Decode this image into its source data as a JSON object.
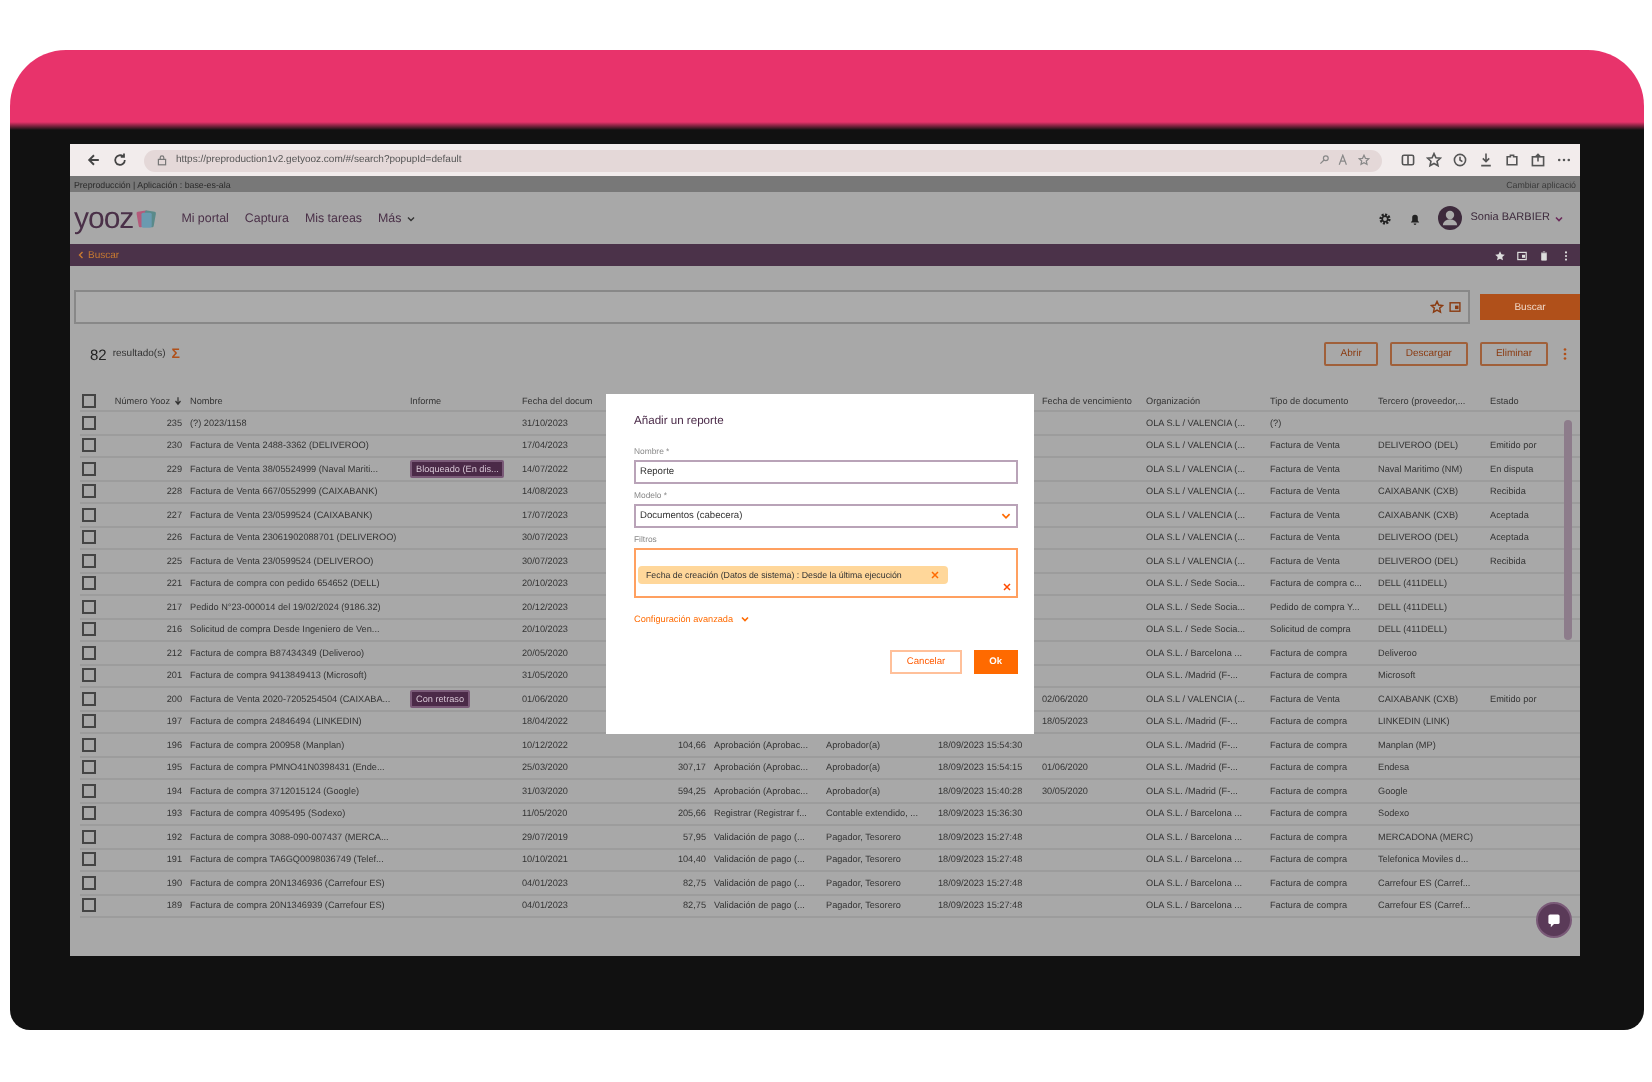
{
  "browser": {
    "url": "https://preproduction1v2.getyooz.com/#/search?popupId=default"
  },
  "environment_bar": {
    "label": "Preproducción | Aplicación : base-es-ala",
    "switch_link": "Cambiar aplicació"
  },
  "app_header": {
    "logo": "yooz",
    "nav": [
      {
        "label": "Mi portal",
        "dropdown": false
      },
      {
        "label": "Captura",
        "dropdown": false
      },
      {
        "label": "Mis tareas",
        "dropdown": false
      },
      {
        "label": "Más",
        "dropdown": true
      }
    ],
    "user": "Sonia BARBIER"
  },
  "breadcrumb": {
    "back": "Buscar"
  },
  "search": {
    "button": "Buscar"
  },
  "results": {
    "count": "82",
    "label": "resultado(s)",
    "sum_symbol": "Σ",
    "actions": [
      "Abrir",
      "Descargar",
      "Eliminar"
    ]
  },
  "table": {
    "all_checked": false,
    "columns": [
      {
        "label": "Número Yooz",
        "sorted": true
      },
      {
        "label": "Nombre",
        "sorted": false
      },
      {
        "label": "Informe",
        "sorted": false
      },
      {
        "label": "Fecha del docum",
        "sorted": false
      },
      {
        "label": "Fecha de vencimiento",
        "sorted": false
      },
      {
        "label": "Organización",
        "sorted": false
      },
      {
        "label": "Tipo de documento",
        "sorted": false
      },
      {
        "label": "Tercero (proveedor,...",
        "sorted": false
      },
      {
        "label": "Estado",
        "sorted": false
      }
    ],
    "rows": [
      {
        "checked": false,
        "number": "235",
        "name": "(?) 2023/1158",
        "document_date": "31/10/2023",
        "organization": "OLA S.L / VALENCIA (...",
        "document_type": "(?)"
      },
      {
        "checked": false,
        "number": "230",
        "name": "Factura de Venta 2488-3362 (DELIVEROO)",
        "document_date": "17/04/2023",
        "organization": "OLA S.L / VALENCIA (...",
        "document_type": "Factura de Venta",
        "third_party": "DELIVEROO (DEL)",
        "status": "Emitido por"
      },
      {
        "checked": false,
        "number": "229",
        "name": "Factura de Venta 38/05524999 (Naval Mariti...",
        "report": "Bloqueado (En dis...",
        "document_date": "14/07/2022",
        "organization": "OLA S.L / VALENCIA (...",
        "document_type": "Factura de Venta",
        "third_party": "Naval Maritimo (NM)",
        "status": "En disputa"
      },
      {
        "checked": false,
        "number": "228",
        "name": "Factura de Venta 667/0552999 (CAIXABANK)",
        "document_date": "14/08/2023",
        "organization": "OLA S.L / VALENCIA (...",
        "document_type": "Factura de Venta",
        "third_party": "CAIXABANK (CXB)",
        "status": "Recibida"
      },
      {
        "checked": false,
        "number": "227",
        "name": "Factura de Venta 23/0599524 (CAIXABANK)",
        "document_date": "17/07/2023",
        "organization": "OLA S.L / VALENCIA (...",
        "document_type": "Factura de Venta",
        "third_party": "CAIXABANK (CXB)",
        "status": "Aceptada"
      },
      {
        "checked": false,
        "number": "226",
        "name": "Factura de Venta 23061902088701 (DELIVEROO)",
        "document_date": "30/07/2023",
        "organization": "OLA S.L / VALENCIA (...",
        "document_type": "Factura de Venta",
        "third_party": "DELIVEROO (DEL)",
        "status": "Aceptada"
      },
      {
        "checked": false,
        "number": "225",
        "name": "Factura de Venta 23/0599524 (DELIVEROO)",
        "document_date": "30/07/2023",
        "organization": "OLA S.L / VALENCIA (...",
        "document_type": "Factura de Venta",
        "third_party": "DELIVEROO (DEL)",
        "status": "Recibida"
      },
      {
        "checked": false,
        "number": "221",
        "name": "Factura de compra con pedido 654652 (DELL)",
        "document_date": "20/10/2023",
        "organization": "OLA S.L. / Sede Socia...",
        "document_type": "Factura de compra c...",
        "third_party": "DELL (411DELL)"
      },
      {
        "checked": false,
        "number": "217",
        "name": "Pedido N°23-000014 del 19/02/2024 (9186.32)",
        "document_date": "20/12/2023",
        "organization": "OLA S.L. / Sede Socia...",
        "document_type": "Pedido de compra Y...",
        "third_party": "DELL (411DELL)"
      },
      {
        "checked": false,
        "number": "216",
        "name": "Solicitud de compra Desde Ingeniero de Ven...",
        "document_date": "20/10/2023",
        "organization": "OLA S.L. / Sede Socia...",
        "document_type": "Solicitud de compra",
        "third_party": "DELL (411DELL)"
      },
      {
        "checked": false,
        "number": "212",
        "name": "Factura de compra B87434349 (Deliveroo)",
        "document_date": "20/05/2020",
        "organization": "OLA S.L. / Barcelona ...",
        "document_type": "Factura de compra",
        "third_party": "Deliveroo"
      },
      {
        "checked": false,
        "number": "201",
        "name": "Factura de compra 9413849413 (Microsoft)",
        "document_date": "31/05/2020",
        "organization": "OLA S.L. /Madrid (F-...",
        "document_type": "Factura de compra",
        "third_party": "Microsoft"
      },
      {
        "checked": false,
        "number": "200",
        "name": "Factura de Venta 2020-7205254504 (CAIXABA...",
        "report": "Con retraso",
        "document_date": "01/06/2020",
        "due_date": "02/06/2020",
        "organization": "OLA S.L / VALENCIA (...",
        "document_type": "Factura de Venta",
        "third_party": "CAIXABANK (CXB)",
        "status": "Emitido por"
      },
      {
        "checked": false,
        "number": "197",
        "name": "Factura de compra 24846494 (LINKEDIN)",
        "document_date": "18/04/2022",
        "due_date": "18/05/2023",
        "organization": "OLA S.L. /Madrid (F-...",
        "document_type": "Factura de compra",
        "third_party": "LINKEDIN (LINK)"
      },
      {
        "checked": false,
        "number": "196",
        "name": "Factura de compra 200958 (Manplan)",
        "document_date": "10/12/2022",
        "amount": "104,66",
        "stage": "Aprobación (Aprobac...",
        "role": "Aprobador(a)",
        "stage_date": "18/09/2023 15:54:30",
        "organization": "OLA S.L. /Madrid (F-...",
        "document_type": "Factura de compra",
        "third_party": "Manplan (MP)"
      },
      {
        "checked": false,
        "number": "195",
        "name": "Factura de compra PMNO41N0398431 (Ende...",
        "document_date": "25/03/2020",
        "amount": "307,17",
        "stage": "Aprobación (Aprobac...",
        "role": "Aprobador(a)",
        "stage_date": "18/09/2023 15:54:15",
        "due_date": "01/06/2020",
        "organization": "OLA S.L. /Madrid (F-...",
        "document_type": "Factura de compra",
        "third_party": "Endesa"
      },
      {
        "checked": false,
        "number": "194",
        "name": "Factura de compra 3712015124 (Google)",
        "document_date": "31/03/2020",
        "amount": "594,25",
        "stage": "Aprobación (Aprobac...",
        "role": "Aprobador(a)",
        "stage_date": "18/09/2023 15:40:28",
        "due_date": "30/05/2020",
        "organization": "OLA S.L. /Madrid (F-...",
        "document_type": "Factura de compra",
        "third_party": "Google"
      },
      {
        "checked": false,
        "number": "193",
        "name": "Factura de compra 4095495 (Sodexo)",
        "document_date": "11/05/2020",
        "amount": "205,66",
        "stage": "Registrar (Registrar f...",
        "role": "Contable extendido, ...",
        "stage_date": "18/09/2023 15:36:30",
        "organization": "OLA S.L. / Barcelona ...",
        "document_type": "Factura de compra",
        "third_party": "Sodexo"
      },
      {
        "checked": false,
        "number": "192",
        "name": "Factura de compra 3088-090-007437 (MERCA...",
        "document_date": "29/07/2019",
        "amount": "57,95",
        "stage": "Validación de pago (...",
        "role": "Pagador, Tesorero",
        "stage_date": "18/09/2023 15:27:48",
        "organization": "OLA S.L. / Barcelona ...",
        "document_type": "Factura de compra",
        "third_party": "MERCADONA (MERC)"
      },
      {
        "checked": false,
        "number": "191",
        "name": "Factura de compra TA6GQ0098036749 (Telef...",
        "document_date": "10/10/2021",
        "amount": "104,40",
        "stage": "Validación de pago (...",
        "role": "Pagador, Tesorero",
        "stage_date": "18/09/2023 15:27:48",
        "organization": "OLA S.L. / Barcelona ...",
        "document_type": "Factura de compra",
        "third_party": "Telefonica Moviles d..."
      },
      {
        "checked": false,
        "number": "190",
        "name": "Factura de compra 20N1346936 (Carrefour ES)",
        "document_date": "04/01/2023",
        "amount": "82,75",
        "stage": "Validación de pago (...",
        "role": "Pagador, Tesorero",
        "stage_date": "18/09/2023 15:27:48",
        "organization": "OLA S.L. / Barcelona ...",
        "document_type": "Factura de compra",
        "third_party": "Carrefour ES (Carref..."
      },
      {
        "checked": false,
        "number": "189",
        "name": "Factura de compra 20N1346939 (Carrefour ES)",
        "document_date": "04/01/2023",
        "amount": "82,75",
        "stage": "Validación de pago (...",
        "role": "Pagador, Tesorero",
        "stage_date": "18/09/2023 15:27:48",
        "organization": "OLA S.L. / Barcelona ...",
        "document_type": "Factura de compra",
        "third_party": "Carrefour ES (Carref..."
      }
    ]
  },
  "dialog": {
    "title": "Añadir un reporte",
    "fields": [
      {
        "kind": "text",
        "label": "Nombre *",
        "value": "Reporte"
      },
      {
        "kind": "select",
        "label": "Modelo *",
        "value": "Documentos (cabecera)"
      },
      {
        "kind": "filters",
        "label": "Filtros",
        "chips": [
          "Fecha de creación (Datos de sistema) : Desde la última ejecución"
        ]
      }
    ],
    "advanced_link": "Configuración avanzada",
    "buttons": [
      {
        "label": "Cancelar",
        "primary": false
      },
      {
        "label": "Ok",
        "primary": true
      }
    ]
  }
}
